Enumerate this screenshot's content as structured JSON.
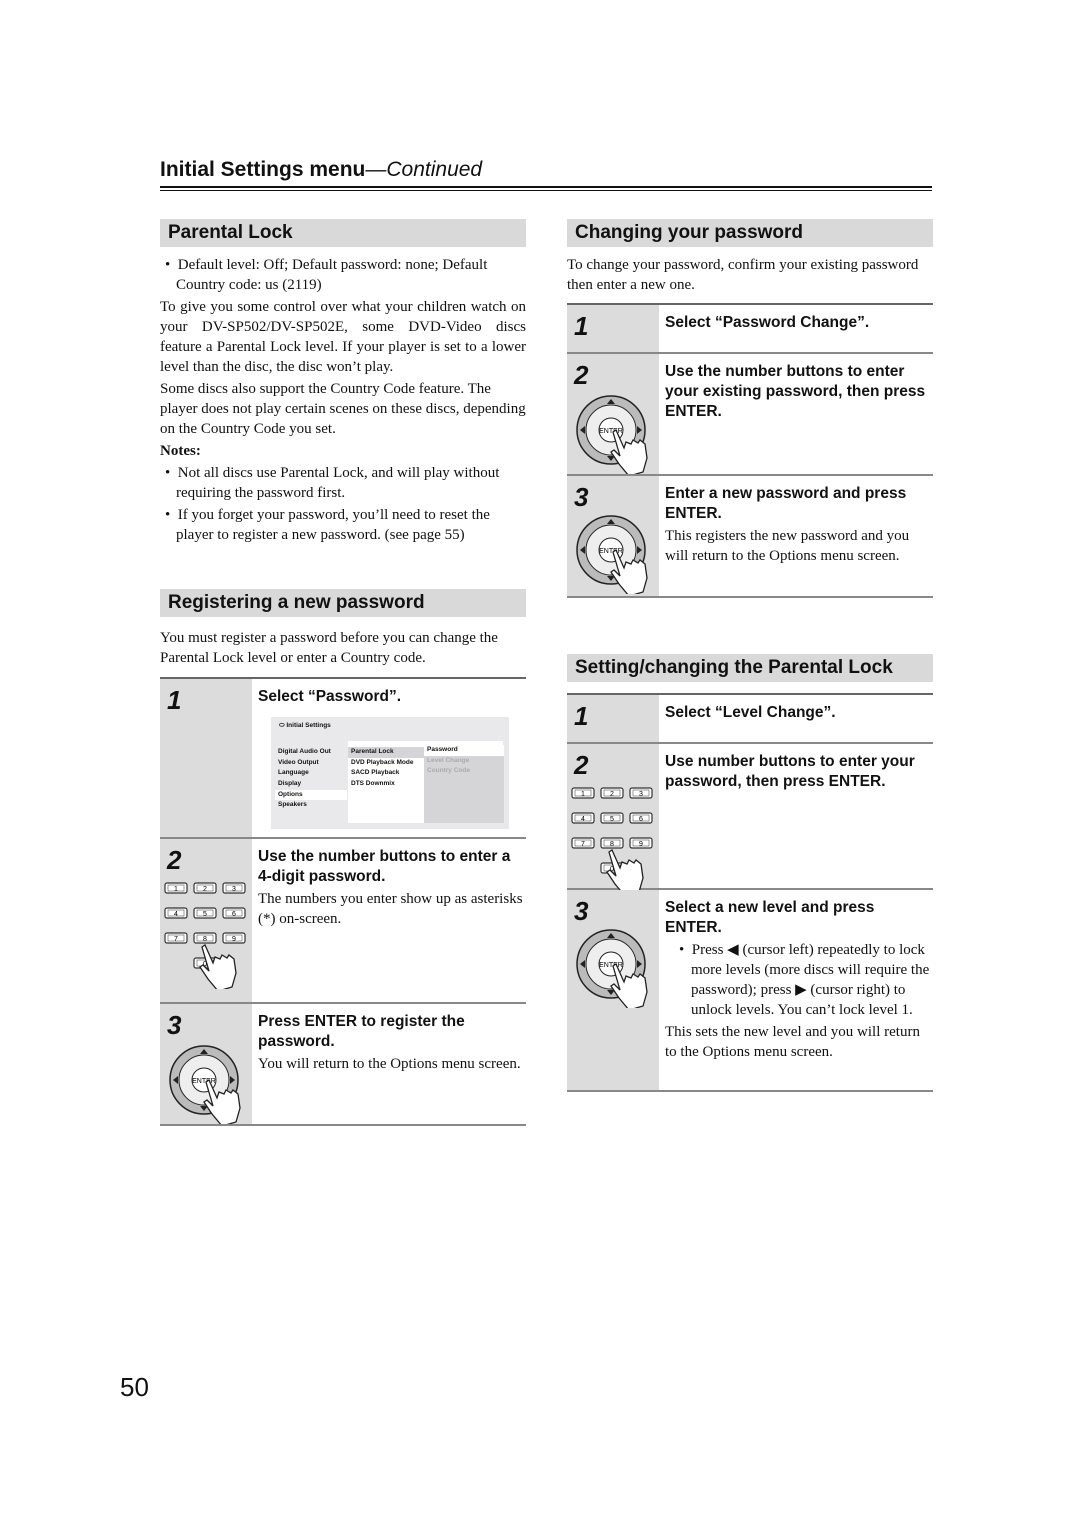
{
  "header": {
    "title": "Initial Settings menu",
    "continued": "—Continued"
  },
  "parental_lock": {
    "heading": "Parental Lock",
    "bullet": "Default level: Off; Default password: none; Default Country code: us (2119)",
    "paragraphs": [
      "To give you some control over what your children watch on your DV-SP502/DV-SP502E, some DVD-Video discs feature a Parental Lock level. If your player is set to a lower level than the disc, the disc won’t play.",
      "Some discs also support the Country Code feature. The player does not play certain scenes on these discs, depending on the Country Code you set."
    ],
    "notes_label": "Notes:",
    "notes": [
      "Not all discs use Parental Lock, and will play without requiring the password first.",
      "If you forget your password, you’ll need to reset the player to register a new password. (see page 55)"
    ]
  },
  "registering": {
    "heading": "Registering a new password",
    "intro": "You must register a password before you can change the Parental Lock level or enter a Country code.",
    "steps": [
      {
        "num": "1",
        "title": "Select “Password”."
      },
      {
        "num": "2",
        "title": "Use the number buttons to enter a 4-digit password.",
        "desc": "The numbers you enter show up as asterisks (*) on-screen."
      },
      {
        "num": "3",
        "title": "Press ENTER to register the password.",
        "desc": "You will return to the Options menu screen."
      }
    ],
    "menu": {
      "title": "Initial Settings",
      "col1": [
        "Digital Audio Out",
        "Video Output",
        "Language",
        "Display",
        "Options",
        "Speakers"
      ],
      "col2": [
        "Parental Lock",
        "DVD Playback Mode",
        "SACD Playback",
        "DTS Downmix"
      ],
      "col3": [
        "Password",
        "Level Change",
        "Country Code"
      ]
    }
  },
  "changing": {
    "heading": "Changing your password",
    "intro": "To change your password, confirm your existing password then enter a new one.",
    "steps": [
      {
        "num": "1",
        "title": "Select “Password Change”."
      },
      {
        "num": "2",
        "title": "Use the number buttons to enter your existing password, then press ENTER."
      },
      {
        "num": "3",
        "title": "Enter a new password and press ENTER.",
        "desc": "This registers the new password and you will return to the Options menu screen."
      }
    ]
  },
  "setting": {
    "heading": "Setting/changing the Parental Lock",
    "steps": [
      {
        "num": "1",
        "title": "Select “Level Change”."
      },
      {
        "num": "2",
        "title": "Use number buttons to enter your password, then press ENTER."
      },
      {
        "num": "3",
        "title": "Select a new level and press ENTER.",
        "bullet": "Press ◀ (cursor left) repeatedly to lock more levels (more discs will require the password); press ▶ (cursor right) to unlock levels. You can’t lock level 1.",
        "desc": "This sets the new level and you will return to the Options menu screen."
      }
    ]
  },
  "keypad": [
    "1",
    "2",
    "3",
    "4",
    "5",
    "6",
    "7",
    "8",
    "9",
    "0"
  ],
  "enter_label": "ENTER",
  "page_number": "50"
}
